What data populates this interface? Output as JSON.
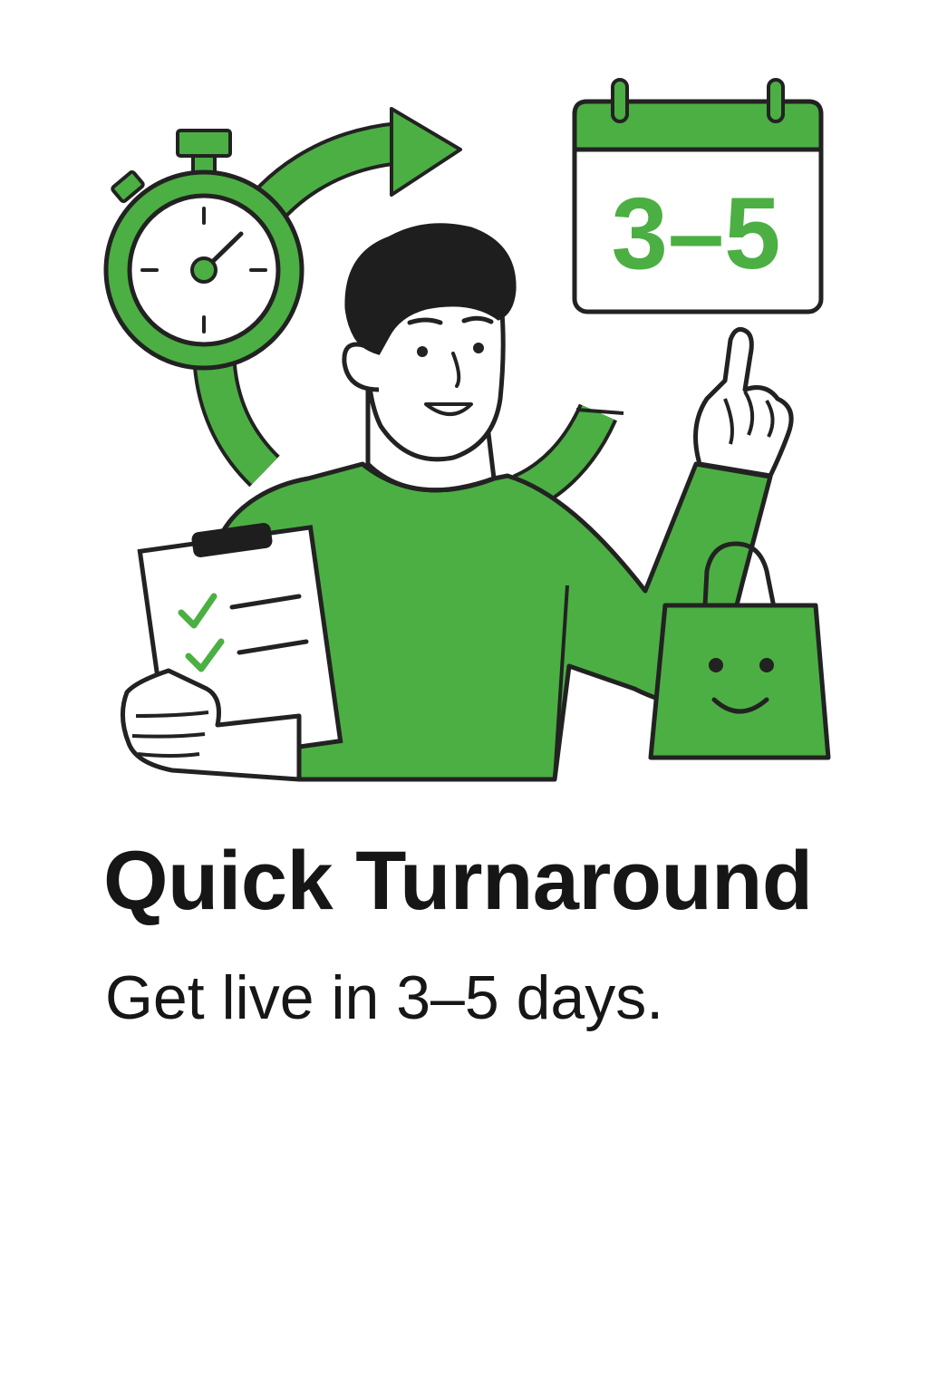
{
  "hero": {
    "title": "Quick Turnaround",
    "subtitle": "Get live in 3–5 days.",
    "calendar_label": "3–5"
  },
  "colors": {
    "accent": "#4caf43",
    "ink": "#161616",
    "background": "#ffffff"
  },
  "icons": [
    "stopwatch-icon",
    "arrow-icon",
    "calendar-icon",
    "clipboard-icon",
    "shopping-bag-icon",
    "checkmark-icon"
  ]
}
